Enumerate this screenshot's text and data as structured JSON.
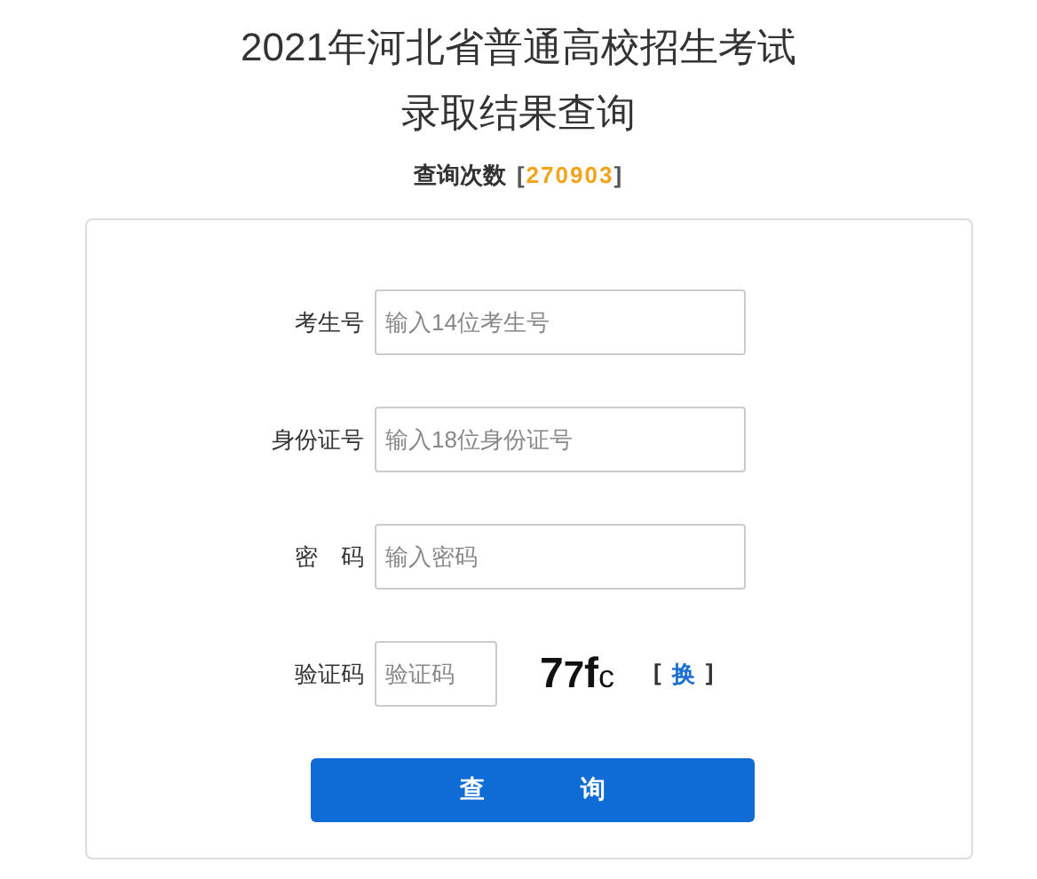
{
  "title_lines": [
    "2021年河北省普通高校招生考试",
    "录取结果查询"
  ],
  "counter": {
    "label": "查询次数",
    "open": "[",
    "value": "270903",
    "close": "]"
  },
  "form": {
    "fields": [
      {
        "kind": "text",
        "label": "考生号",
        "placeholder": "输入14位考生号"
      },
      {
        "kind": "text",
        "label": "身份证号",
        "placeholder": "输入18位身份证号"
      },
      {
        "kind": "password",
        "label": "密　码",
        "placeholder": "输入密码"
      },
      {
        "kind": "captcha",
        "label": "验证码",
        "placeholder": "验证码",
        "captcha": "77fc",
        "refresh": {
          "open": "[",
          "text": "换",
          "close": "]"
        }
      }
    ],
    "submit": "查　询"
  }
}
